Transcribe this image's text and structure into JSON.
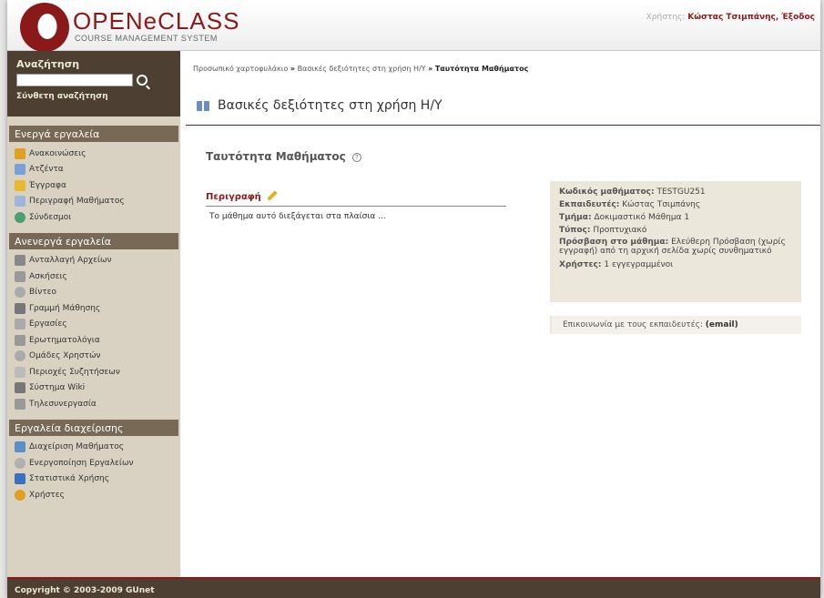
{
  "header": {
    "logo_text": "OPENeCLASS",
    "logo_sub": "COURSE MANAGEMENT SYSTEM",
    "user_label": "Χρήστης:",
    "user_name": "Κώστας Τσιμπάνης,",
    "logout": "Έξοδος"
  },
  "sidebar": {
    "search_title": "Αναζήτηση",
    "search_placeholder": "",
    "advanced_search": "Σύνθετη αναζήτηση",
    "active_tools_title": "Ενεργά εργαλεία",
    "active_tools": [
      {
        "label": "Ανακοινώσεις",
        "icon": "megaphone-icon",
        "color": "#e0a020"
      },
      {
        "label": "Ατζέντα",
        "icon": "calendar-icon",
        "color": "#7aa0d8"
      },
      {
        "label": "Έγγραφα",
        "icon": "folder-icon",
        "color": "#e8b830"
      },
      {
        "label": "Περιγραφή Μαθήματος",
        "icon": "list-icon",
        "color": "#9fb6dc"
      },
      {
        "label": "Σύνδεσμοι",
        "icon": "globe-icon",
        "color": "#4aa070"
      }
    ],
    "inactive_tools_title": "Ανενεργά εργαλεία",
    "inactive_tools": [
      {
        "label": "Ανταλλαγή Αρχείων",
        "icon": "file-exchange-icon",
        "color": "#888888"
      },
      {
        "label": "Ασκήσεις",
        "icon": "pencil-icon",
        "color": "#999999"
      },
      {
        "label": "Βίντεο",
        "icon": "video-icon",
        "color": "#aaaaaa"
      },
      {
        "label": "Γραμμή Μάθησης",
        "icon": "footsteps-icon",
        "color": "#777777"
      },
      {
        "label": "Εργασίες",
        "icon": "assignment-icon",
        "color": "#aaaaaa"
      },
      {
        "label": "Ερωτηματολόγια",
        "icon": "questionnaire-icon",
        "color": "#999999"
      },
      {
        "label": "Ομάδες Χρηστών",
        "icon": "group-icon",
        "color": "#aaaaaa"
      },
      {
        "label": "Περιοχές Συζητήσεων",
        "icon": "chat-icon",
        "color": "#bbbbbb"
      },
      {
        "label": "Σύστημα Wiki",
        "icon": "wiki-icon",
        "color": "#777777"
      },
      {
        "label": "Τηλεσυνεργασία",
        "icon": "telecollab-icon",
        "color": "#999999"
      }
    ],
    "admin_tools_title": "Εργαλεία διαχείρισης",
    "admin_tools": [
      {
        "label": "Διαχείριση Μαθήματος",
        "icon": "course-admin-icon",
        "color": "#5a90c8"
      },
      {
        "label": "Ενεργοποίηση Εργαλείων",
        "icon": "gear-icon",
        "color": "#b0b0b0"
      },
      {
        "label": "Στατιστικά Χρήσης",
        "icon": "bar-chart-icon",
        "color": "#3a70c0"
      },
      {
        "label": "Χρήστες",
        "icon": "users-icon",
        "color": "#e0a020"
      }
    ]
  },
  "main": {
    "breadcrumb": {
      "portfolio": "Προσωπικό χαρτοφυλάκιο",
      "sep": "»",
      "course": "Βασικές δεξιότητες στη χρήση Η/Υ",
      "current": "Ταυτότητα Μαθήματος"
    },
    "course_title": "Βασικές δεξιότητες στη χρήση Η/Υ",
    "page_heading": "Ταυτότητα Μαθήματος",
    "help_glyph": "?",
    "description_label": "Περιγραφή",
    "description_text": "Το μάθημα αυτό διεξάγεται στα πλαίσια ...",
    "info": {
      "code_label": "Κωδικός μαθήματος:",
      "code": "TESTGU251",
      "instructors_label": "Εκπαιδευτές:",
      "instructors": "Κώστας Τσιμπάνης",
      "department_label": "Τμήμα:",
      "department": "Δοκιμαστικό Μάθημα 1",
      "type_label": "Τύπος:",
      "type": "Προπτυχιακό",
      "access_label": "Πρόσβαση στο μάθημα:",
      "access": "Ελεύθερη Πρόσβαση (χωρίς εγγραφή) από τη αρχική σελίδα χωρίς συνθηματικό",
      "users_label": "Χρήστες:",
      "users": "1 εγγεγραμμένοι"
    },
    "contact_text": "Επικοινωνία με τους εκπαιδευτές:",
    "contact_link": "(email)"
  },
  "footer": {
    "copyright": "Copyright © 2003-2009 GUnet"
  }
}
